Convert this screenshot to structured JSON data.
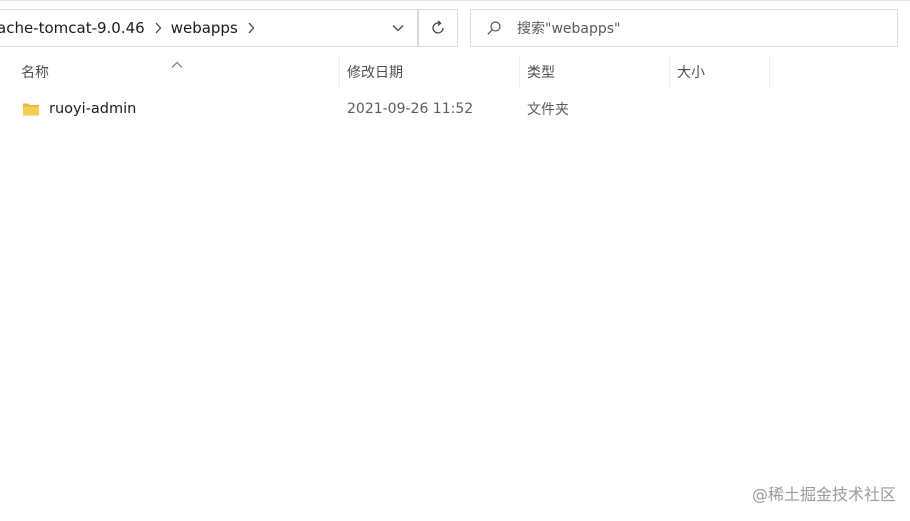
{
  "address_bar": {
    "breadcrumbs": [
      "ache-tomcat-9.0.46",
      "webapps"
    ]
  },
  "search": {
    "placeholder": "搜索\"webapps\""
  },
  "columns": {
    "name": "名称",
    "date_modified": "修改日期",
    "type": "类型",
    "size": "大小"
  },
  "files": [
    {
      "name": "ruoyi-admin",
      "date_modified": "2021-09-26 11:52",
      "type": "文件夹",
      "size": "",
      "icon": "folder-icon"
    }
  ],
  "watermark": "@稀土掘金技术社区",
  "colors": {
    "folder": "#f0c44b",
    "border": "#d9d9d9"
  }
}
